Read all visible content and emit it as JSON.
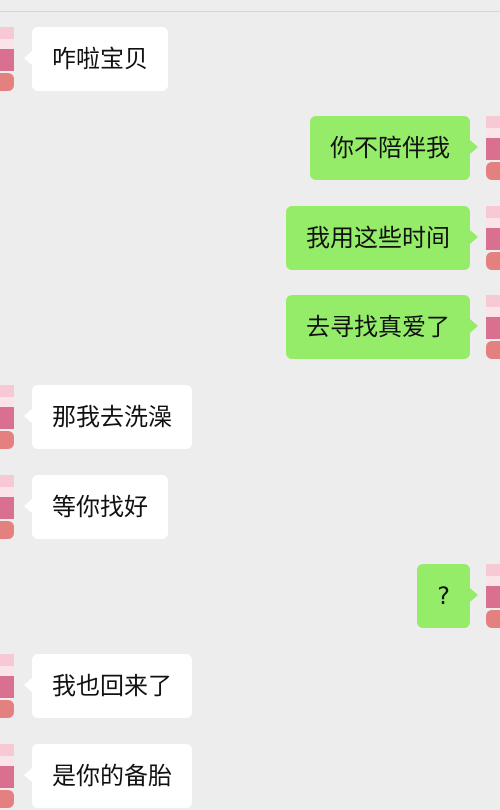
{
  "messages": [
    {
      "side": "left",
      "text": "咋啦宝贝"
    },
    {
      "side": "right",
      "text": "你不陪伴我"
    },
    {
      "side": "right",
      "text": "我用这些时间"
    },
    {
      "side": "right",
      "text": "去寻找真爱了"
    },
    {
      "side": "left",
      "text": "那我去洗澡"
    },
    {
      "side": "left",
      "text": "等你找好"
    },
    {
      "side": "right",
      "text": "?"
    },
    {
      "side": "left",
      "text": "我也回来了"
    },
    {
      "side": "left",
      "text": "是你的备胎"
    }
  ],
  "colors": {
    "background": "#ededed",
    "incoming_bubble": "#ffffff",
    "outgoing_bubble": "#95ec69"
  },
  "icons": {
    "avatar": "avatar-icon"
  }
}
